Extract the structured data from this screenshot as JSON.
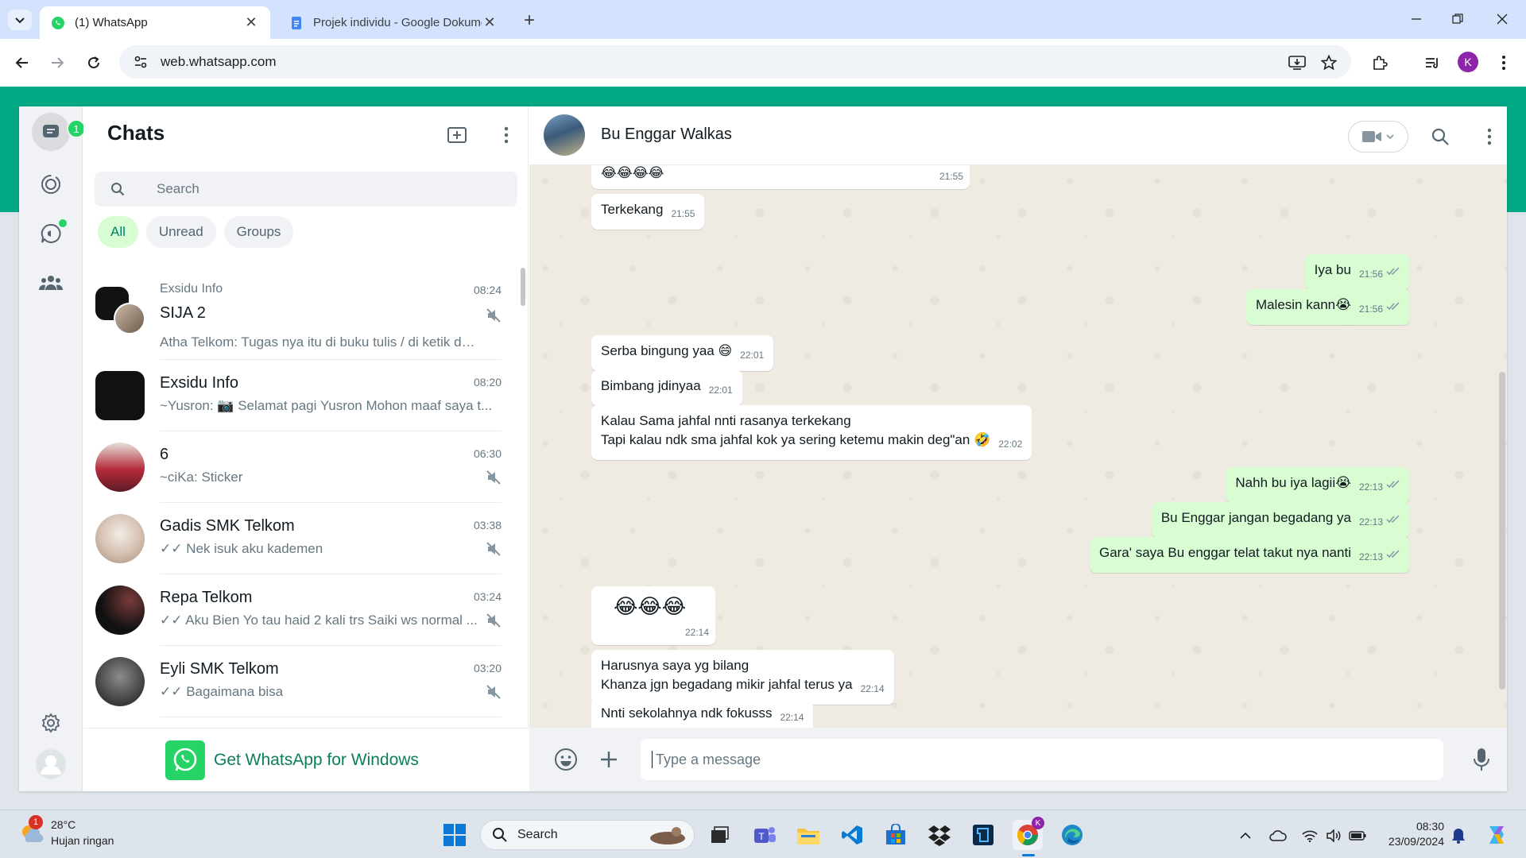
{
  "browser": {
    "tabs": [
      {
        "title": "(1) WhatsApp",
        "active": true
      },
      {
        "title": "Projek individu - Google Dokumen",
        "active": false
      }
    ],
    "url": "web.whatsapp.com",
    "profile_initial": "K"
  },
  "rail": {
    "chats_badge": "1"
  },
  "chat_list": {
    "title": "Chats",
    "search_placeholder": "Search",
    "filters": [
      "All",
      "Unread",
      "Groups"
    ],
    "chats": [
      {
        "pre": "Exsidu Info",
        "name": "SIJA 2",
        "time": "08:24",
        "message": "Atha Telkom: Tugas nya itu di buku tulis / di ketik di w...",
        "muted": true
      },
      {
        "name": "Exsidu Info",
        "time": "08:20",
        "message": "~Yusron: 📷 Selamat pagi Yusron Mohon maaf saya t...",
        "muted": false
      },
      {
        "name": "6",
        "time": "06:30",
        "message": "~ciKa: Sticker",
        "muted": true
      },
      {
        "name": "Gadis SMK Telkom",
        "time": "03:38",
        "message": "✓✓ Nek isuk aku kademen",
        "muted": true
      },
      {
        "name": "Repa Telkom",
        "time": "03:24",
        "message": "✓✓ Aku Bien Yo tau haid 2 kali trs Saiki ws normal ...",
        "muted": true
      },
      {
        "name": "Eyli SMK Telkom",
        "time": "03:20",
        "message": "✓✓ Bagaimana bisa",
        "muted": true
      }
    ],
    "get_app": "Get WhatsApp for Windows"
  },
  "conversation": {
    "contact": "Bu Enggar Walkas",
    "input_placeholder": "Type a message",
    "messages": [
      {
        "dir": "in",
        "text": "😂😂😂😂",
        "time": "21:55"
      },
      {
        "dir": "in",
        "text": "Terkekang",
        "time": "21:55"
      },
      {
        "dir": "out",
        "text": "Iya bu",
        "time": "21:56"
      },
      {
        "dir": "out",
        "text": "Malesin kann😭",
        "time": "21:56"
      },
      {
        "dir": "in",
        "text": "Serba bingung yaa 😄",
        "time": "22:01"
      },
      {
        "dir": "in",
        "text": "Bimbang jdinyaa",
        "time": "22:01"
      },
      {
        "dir": "in",
        "text": "Kalau Sama jahfal nnti rasanya terkekang\nTapi kalau ndk sma jahfal kok ya sering ketemu makin deg\"an 🤣",
        "time": "22:02"
      },
      {
        "dir": "out",
        "text": "Nahh bu iya lagii😭",
        "time": "22:13"
      },
      {
        "dir": "out",
        "text": "Bu Enggar jangan begadang ya",
        "time": "22:13"
      },
      {
        "dir": "out",
        "text": "Gara' saya Bu enggar telat takut nya nanti",
        "time": "22:13"
      },
      {
        "dir": "in",
        "text": "😂😂😂",
        "time": "22:14"
      },
      {
        "dir": "in",
        "text": "Harusnya saya yg bilang\nKhanza jgn begadang mikir jahfal terus ya",
        "time": "22:14"
      },
      {
        "dir": "in",
        "text": "Nnti sekolahnya ndk fokusss",
        "time": "22:14"
      }
    ]
  },
  "taskbar": {
    "weather_badge": "1",
    "temperature": "28°C",
    "condition": "Hujan ringan",
    "search_label": "Search",
    "time": "08:30",
    "date": "23/09/2024"
  },
  "colors": {
    "whatsapp_green": "#00a884",
    "outgoing_bubble": "#d9fdd3",
    "incoming_bubble": "#ffffff",
    "chat_wallpaper": "#efeae2",
    "read_ticks": "#53bdeb"
  }
}
